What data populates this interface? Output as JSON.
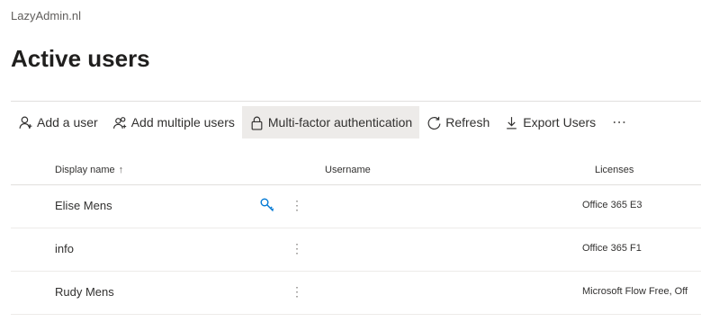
{
  "org_name": "LazyAdmin.nl",
  "page_title": "Active users",
  "toolbar": {
    "add_user": "Add a user",
    "add_multiple": "Add multiple users",
    "mfa": "Multi-factor authentication",
    "refresh": "Refresh",
    "export": "Export Users",
    "more": "⋯"
  },
  "table": {
    "columns": {
      "display_name": "Display name",
      "username": "Username",
      "licenses": "Licenses"
    },
    "sort_indicator": "↑",
    "rows": [
      {
        "display_name": "Elise Mens",
        "username": "",
        "licenses": "Office 365 E3",
        "icon": "key-icon"
      },
      {
        "display_name": "info",
        "username": "",
        "licenses": "Office 365 F1"
      },
      {
        "display_name": "Rudy Mens",
        "username": "",
        "licenses": "Microsoft Flow Free, Off"
      }
    ],
    "row_menu": "⋮"
  },
  "colors": {
    "accent": "#0078d4",
    "active_bg": "#edebe9"
  }
}
